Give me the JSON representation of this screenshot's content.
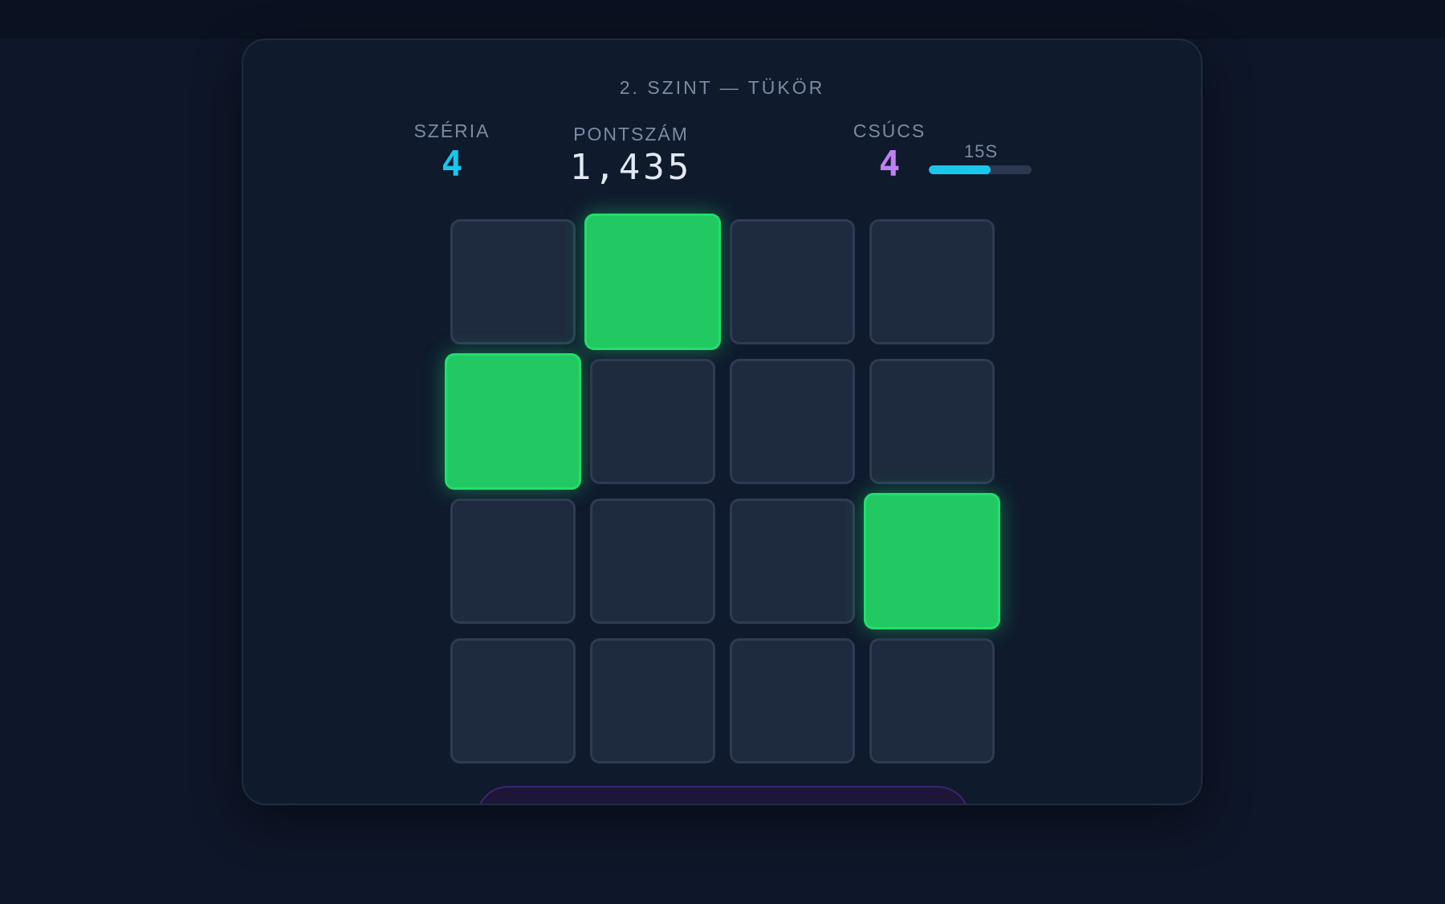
{
  "game": {
    "level_title": "2. SZINT — TÜKÖR",
    "stats": {
      "streak_label": "SZÉRIA",
      "streak_value": "4",
      "score_label": "PONTSZÁM",
      "score_value": "1,435",
      "best_label": "CSÚCS",
      "best_value": "4"
    },
    "timer": {
      "label": "15S",
      "fill_fraction": 0.6
    },
    "grid": {
      "rows": 4,
      "cols": 4,
      "lit_cells": [
        [
          0,
          1
        ],
        [
          1,
          0
        ],
        [
          2,
          3
        ]
      ]
    },
    "bottom_button_label": ""
  },
  "colors": {
    "accent_cyan": "#19c6ec",
    "accent_purple": "#c27ef5",
    "tile_lit": "#22c862",
    "tile_idle": "#1e2a3e",
    "panel_bg": "#0f1a2d"
  }
}
